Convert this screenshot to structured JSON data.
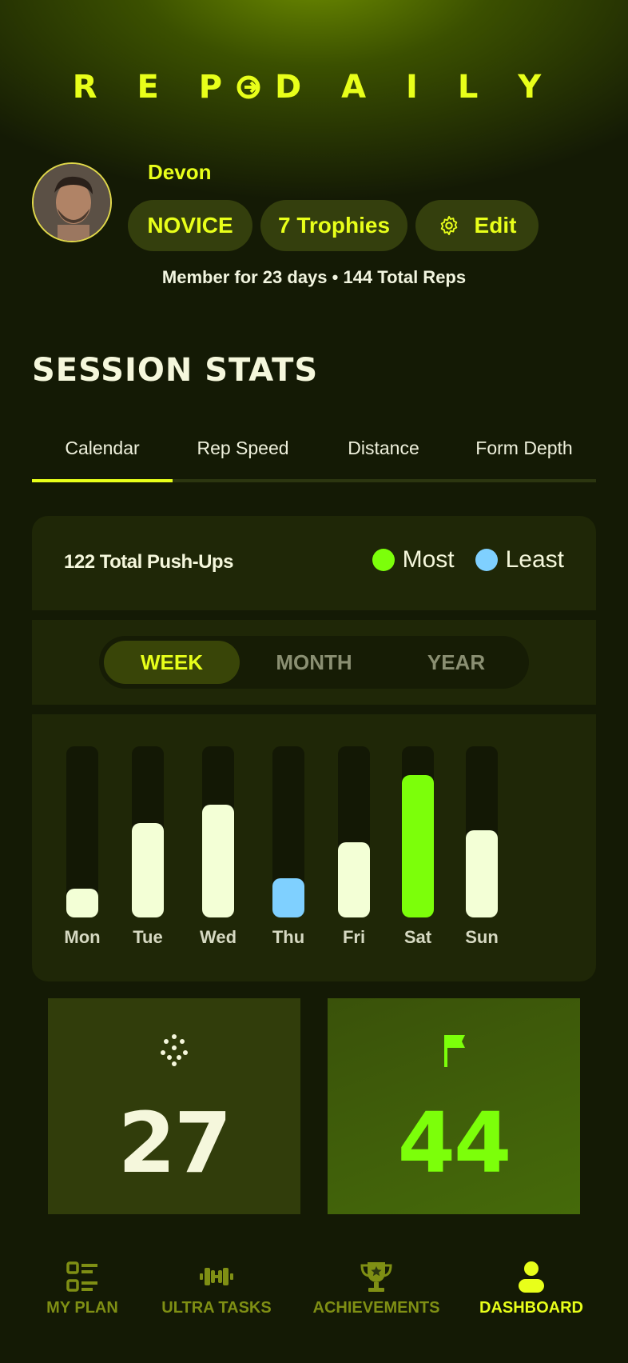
{
  "app": {
    "logo_text": "REP DAILY"
  },
  "profile": {
    "name": "Devon",
    "rank": "NOVICE",
    "trophies": "7 Trophies",
    "edit_label": "Edit",
    "member_line": "Member for 23 days • 144 Total Reps"
  },
  "stats": {
    "title": "SESSION STATS",
    "tabs": [
      "Calendar",
      "Rep Speed",
      "Distance",
      "Form Depth"
    ],
    "active_tab": "Calendar",
    "total_label": "122 Total Push-Ups",
    "legend": [
      {
        "label": "Most",
        "color": "#7cff0a"
      },
      {
        "label": "Least",
        "color": "#7fd0ff"
      }
    ],
    "ranges": [
      "WEEK",
      "MONTH",
      "YEAR"
    ],
    "active_range": "WEEK"
  },
  "chart_data": {
    "type": "bar",
    "categories": [
      "Mon",
      "Tue",
      "Wed",
      "Thu",
      "Fri",
      "Sat",
      "Sun"
    ],
    "values": [
      0.17,
      0.55,
      0.66,
      0.23,
      0.44,
      0.83,
      0.51
    ],
    "ylim": [
      0,
      1
    ],
    "highlight": {
      "Sat": "most",
      "Thu": "least"
    },
    "colors": {
      "default": "#f3ffd6",
      "most": "#7cff0a",
      "least": "#7fd0ff",
      "track": "#131805"
    }
  },
  "summary_cards": [
    {
      "icon": "dots-icon",
      "value": "27",
      "color": "#f5f7dc"
    },
    {
      "icon": "flag-icon",
      "value": "44",
      "color": "#7cff0a"
    }
  ],
  "nav": [
    {
      "label": "MY PLAN",
      "icon": "list-icon",
      "active": false
    },
    {
      "label": "ULTRA TASKS",
      "icon": "dumbbell-icon",
      "active": false
    },
    {
      "label": "ACHIEVEMENTS",
      "icon": "trophy-icon",
      "active": false
    },
    {
      "label": "DASHBOARD",
      "icon": "person-icon",
      "active": true
    }
  ],
  "colors": {
    "accent": "#e8ff1a",
    "background": "#141a05",
    "card": "#1f2707"
  }
}
